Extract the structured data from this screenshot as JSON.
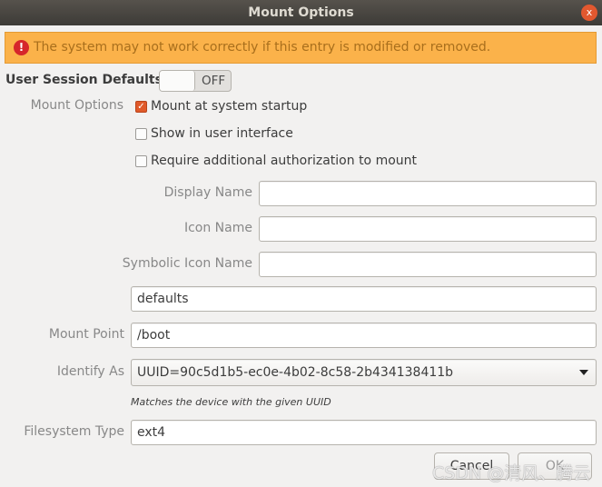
{
  "window": {
    "title": "Mount Options",
    "close_label": "x"
  },
  "warning": {
    "icon": "error-icon",
    "text": "The system may not work correctly if this entry is modified or removed."
  },
  "user_session": {
    "label": "User Session Defaults",
    "toggle_state": "OFF"
  },
  "mount_options": {
    "label": "Mount Options",
    "checkboxes": [
      {
        "label": "Mount at system startup",
        "checked": true
      },
      {
        "label": "Show in user interface",
        "checked": false
      },
      {
        "label": "Require additional authorization to mount",
        "checked": false
      }
    ],
    "display_name": {
      "label": "Display Name",
      "value": ""
    },
    "icon_name": {
      "label": "Icon Name",
      "value": ""
    },
    "symbolic_icon_name": {
      "label": "Symbolic Icon Name",
      "value": ""
    },
    "options_value": "defaults"
  },
  "mount_point": {
    "label": "Mount Point",
    "value": "/boot"
  },
  "identify_as": {
    "label": "Identify As",
    "value": "UUID=90c5d1b5-ec0e-4b02-8c58-2b434138411b",
    "hint": "Matches the device with the given UUID"
  },
  "filesystem_type": {
    "label": "Filesystem Type",
    "value": "ext4"
  },
  "buttons": {
    "cancel": "Cancel",
    "ok": "OK"
  },
  "watermark": "CSDN @清风、腾云",
  "colors": {
    "accent": "#e05a2a",
    "warning_bg": "#fbb24a",
    "titlebar": "#3d3b37"
  }
}
